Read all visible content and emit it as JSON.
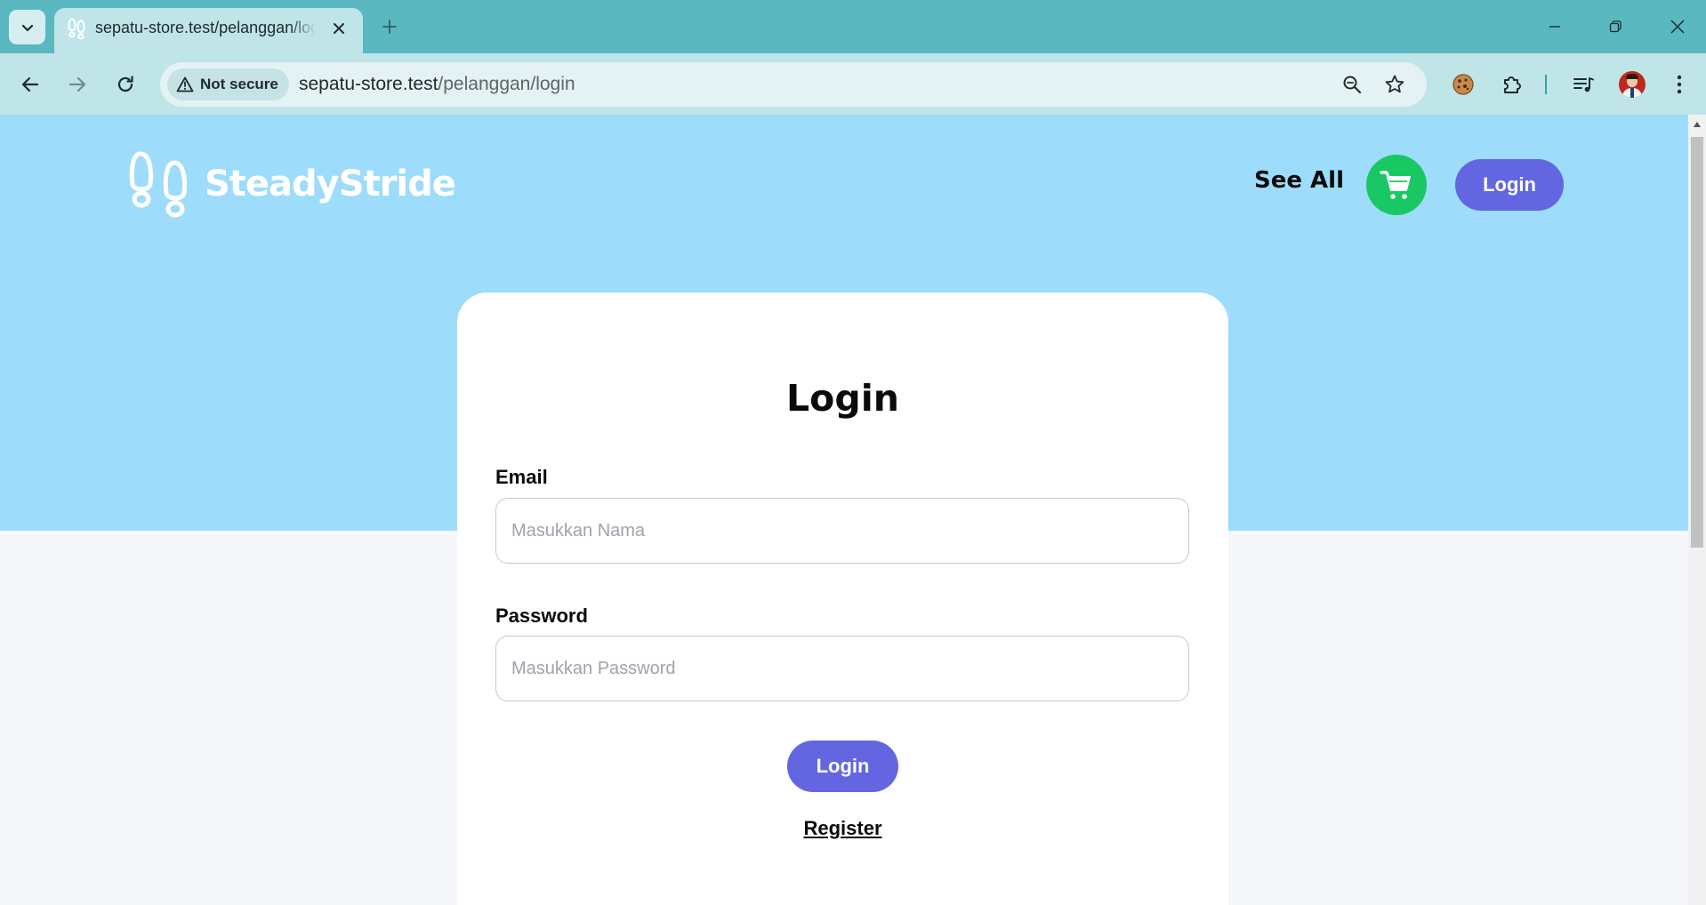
{
  "browser": {
    "tab": {
      "title": "sepatu-store.test/pelanggan/login"
    },
    "omnibox": {
      "security_label": "Not secure",
      "url_host": "sepatu-store.test",
      "url_path": "/pelanggan/login"
    }
  },
  "page": {
    "brand": {
      "name": "SteadyStride"
    },
    "nav": {
      "see_all": "See All",
      "login": "Login"
    },
    "login_card": {
      "title": "Login",
      "email_label": "Email",
      "email_placeholder": "Masukkan Nama",
      "password_label": "Password",
      "password_placeholder": "Masukkan Password",
      "submit_label": "Login",
      "register_link": "Register"
    }
  },
  "colors": {
    "browser_frame": "#5ab8c1",
    "toolbar": "#bfe5e8",
    "hero_background": "#9edcfb",
    "primary_button": "#6366e0",
    "cart_button": "#1ac863"
  }
}
